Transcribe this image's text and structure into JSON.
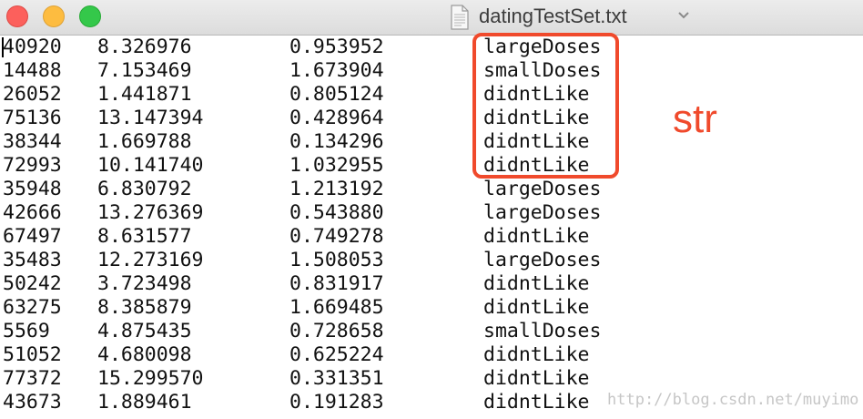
{
  "window": {
    "title": "datingTestSet.txt",
    "controls": [
      "close-button",
      "minimize-button",
      "zoom-button"
    ]
  },
  "rows": [
    [
      "40920",
      "8.326976",
      "0.953952",
      "largeDoses"
    ],
    [
      "14488",
      "7.153469",
      "1.673904",
      "smallDoses"
    ],
    [
      "26052",
      "1.441871",
      "0.805124",
      "didntLike"
    ],
    [
      "75136",
      "13.147394",
      "0.428964",
      "didntLike"
    ],
    [
      "38344",
      "1.669788",
      "0.134296",
      "didntLike"
    ],
    [
      "72993",
      "10.141740",
      "1.032955",
      "didntLike"
    ],
    [
      "35948",
      "6.830792",
      "1.213192",
      "largeDoses"
    ],
    [
      "42666",
      "13.276369",
      "0.543880",
      "largeDoses"
    ],
    [
      "67497",
      "8.631577",
      "0.749278",
      "didntLike"
    ],
    [
      "35483",
      "12.273169",
      "1.508053",
      "largeDoses"
    ],
    [
      "50242",
      "3.723498",
      "0.831917",
      "didntLike"
    ],
    [
      "63275",
      "8.385879",
      "1.669485",
      "didntLike"
    ],
    [
      "5569",
      "4.875435",
      "0.728658",
      "smallDoses"
    ],
    [
      "51052",
      "4.680098",
      "0.625224",
      "didntLike"
    ],
    [
      "77372",
      "15.299570",
      "0.331351",
      "didntLike"
    ],
    [
      "43673",
      "1.889461",
      "0.191283",
      "didntLike"
    ]
  ],
  "annotation": {
    "label": "str",
    "color": "#f04a2c"
  },
  "watermark": "http://blog.csdn.net/muyimo",
  "colors": {
    "close": "#fc605c",
    "minimize": "#fdbc40",
    "zoom": "#34c84a"
  }
}
